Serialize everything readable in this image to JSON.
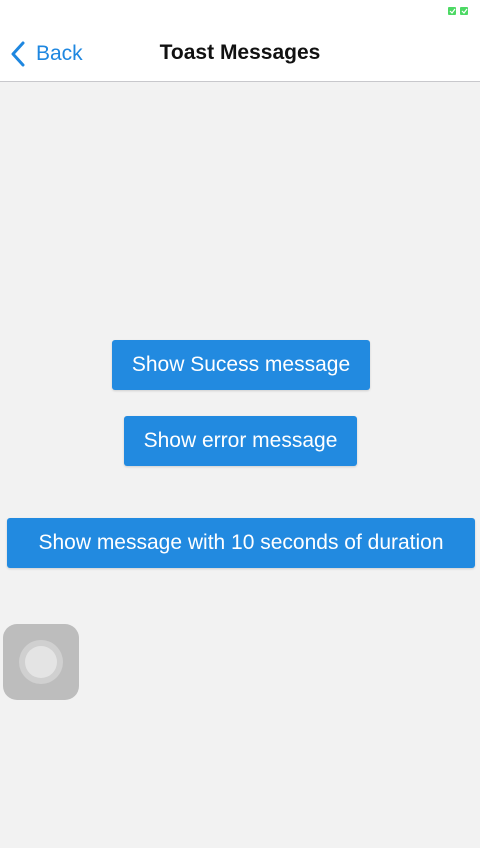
{
  "nav": {
    "back_label": "Back",
    "title": "Toast Messages"
  },
  "buttons": {
    "success_label": "Show Sucess message",
    "error_label": "Show error message",
    "duration_label": "Show message with 10 seconds of duration"
  },
  "colors": {
    "accent": "#1e87e0",
    "button_bg": "#228ae0",
    "background": "#f2f2f2",
    "status_indicator": "#4cd964"
  },
  "icons": {
    "back": "chevron-left-icon",
    "status": "status-indicator-icon",
    "assistive": "assistive-touch-icon"
  }
}
